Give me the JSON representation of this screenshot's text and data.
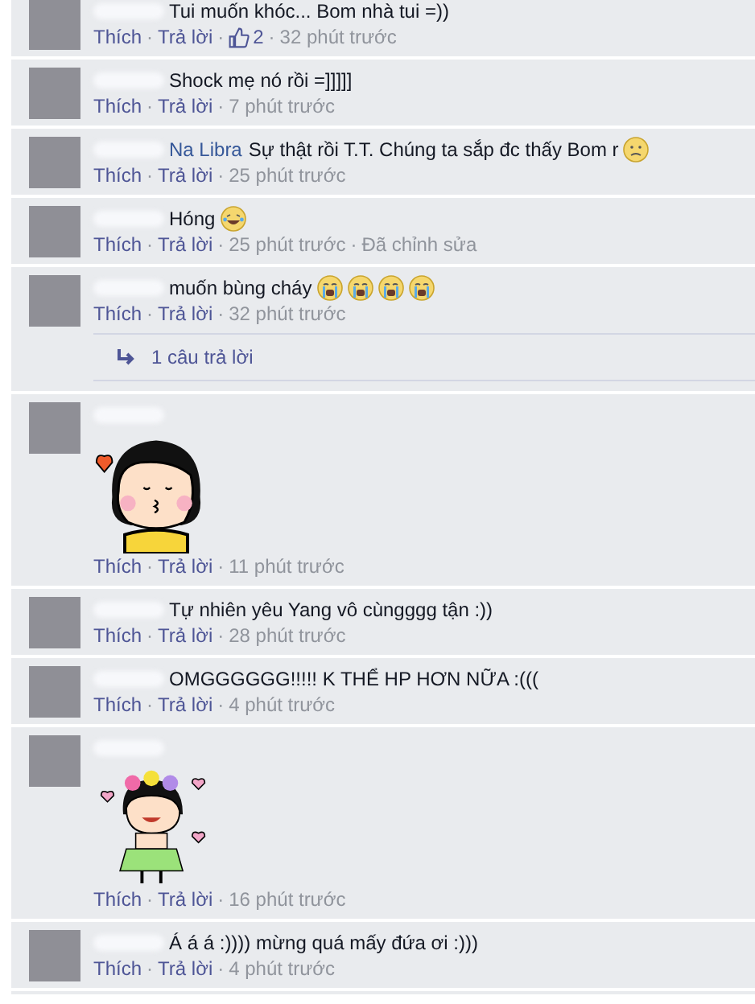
{
  "comments": [
    {
      "kind": "text",
      "body": [
        {
          "kind": "text",
          "text": "Tui muốn khóc... Bom nhà tui =))"
        }
      ],
      "footer": [
        {
          "kind": "link",
          "text": "Thích"
        },
        {
          "kind": "dot",
          "text": "·"
        },
        {
          "kind": "link",
          "text": "Trả lời"
        },
        {
          "kind": "dot",
          "text": "·"
        },
        {
          "kind": "likes",
          "text": "2"
        },
        {
          "kind": "dot",
          "text": "·"
        },
        {
          "kind": "time",
          "text": "32 phút trước"
        }
      ]
    },
    {
      "kind": "text",
      "body": [
        {
          "kind": "text",
          "text": "Shock mẹ nó rồi =]]]]]"
        }
      ],
      "footer": [
        {
          "kind": "link",
          "text": "Thích"
        },
        {
          "kind": "dot",
          "text": "·"
        },
        {
          "kind": "link",
          "text": "Trả lời"
        },
        {
          "kind": "dot",
          "text": "·"
        },
        {
          "kind": "time",
          "text": "7 phút trước"
        }
      ]
    },
    {
      "kind": "text",
      "body": [
        {
          "kind": "name",
          "text": "Na Libra"
        },
        {
          "kind": "text",
          "text": "Sự thật rồi T.T. Chúng ta sắp đc thấy Bom r"
        },
        {
          "kind": "frown"
        }
      ],
      "footer": [
        {
          "kind": "link",
          "text": "Thích"
        },
        {
          "kind": "dot",
          "text": "·"
        },
        {
          "kind": "link",
          "text": "Trả lời"
        },
        {
          "kind": "dot",
          "text": "·"
        },
        {
          "kind": "time",
          "text": "25 phút trước"
        }
      ]
    },
    {
      "kind": "text",
      "body": [
        {
          "kind": "text",
          "text": "Hóng"
        },
        {
          "kind": "laugh-tears"
        }
      ],
      "footer": [
        {
          "kind": "link",
          "text": "Thích"
        },
        {
          "kind": "dot",
          "text": "·"
        },
        {
          "kind": "link",
          "text": "Trả lời"
        },
        {
          "kind": "dot",
          "text": "·"
        },
        {
          "kind": "time",
          "text": "25 phút trước"
        },
        {
          "kind": "dot",
          "text": "·"
        },
        {
          "kind": "time",
          "text": "Đã chỉnh sửa"
        }
      ]
    },
    {
      "kind": "text",
      "body": [
        {
          "kind": "text",
          "text": "muốn bùng cháy"
        },
        {
          "kind": "crying"
        },
        {
          "kind": "crying"
        },
        {
          "kind": "crying"
        },
        {
          "kind": "crying"
        }
      ],
      "footer": [
        {
          "kind": "link",
          "text": "Thích"
        },
        {
          "kind": "dot",
          "text": "·"
        },
        {
          "kind": "link",
          "text": "Trả lời"
        },
        {
          "kind": "dot",
          "text": "·"
        },
        {
          "kind": "time",
          "text": "32 phút trước"
        }
      ],
      "replies": "1 câu trả lời"
    },
    {
      "kind": "kiss-sticker",
      "footer": [
        {
          "kind": "link",
          "text": "Thích"
        },
        {
          "kind": "dot",
          "text": "·"
        },
        {
          "kind": "link",
          "text": "Trả lời"
        },
        {
          "kind": "dot",
          "text": "·"
        },
        {
          "kind": "time",
          "text": "11 phút trước"
        }
      ]
    },
    {
      "kind": "text",
      "body": [
        {
          "kind": "text",
          "text": "Tự nhiên yêu Yang vô cùngggg tận :))"
        }
      ],
      "footer": [
        {
          "kind": "link",
          "text": "Thích"
        },
        {
          "kind": "dot",
          "text": "·"
        },
        {
          "kind": "link",
          "text": "Trả lời"
        },
        {
          "kind": "dot",
          "text": "·"
        },
        {
          "kind": "time",
          "text": "28 phút trước"
        }
      ]
    },
    {
      "kind": "text",
      "body": [
        {
          "kind": "text",
          "text": "OMGGGGGG!!!!! K THỂ HP HƠN NỮA :((("
        }
      ],
      "footer": [
        {
          "kind": "link",
          "text": "Thích"
        },
        {
          "kind": "dot",
          "text": "·"
        },
        {
          "kind": "link",
          "text": "Trả lời"
        },
        {
          "kind": "dot",
          "text": "·"
        },
        {
          "kind": "time",
          "text": "4 phút trước"
        }
      ]
    },
    {
      "kind": "hula-sticker",
      "footer": [
        {
          "kind": "link",
          "text": "Thích"
        },
        {
          "kind": "dot",
          "text": "·"
        },
        {
          "kind": "link",
          "text": "Trả lời"
        },
        {
          "kind": "dot",
          "text": "·"
        },
        {
          "kind": "time",
          "text": "16 phút trước"
        }
      ]
    },
    {
      "kind": "text",
      "body": [
        {
          "kind": "text",
          "text": "Á á á :)))) mừng quá mấy đứa ơi :)))"
        }
      ],
      "footer": [
        {
          "kind": "link",
          "text": "Thích"
        },
        {
          "kind": "dot",
          "text": "·"
        },
        {
          "kind": "link",
          "text": "Trả lời"
        },
        {
          "kind": "dot",
          "text": "·"
        },
        {
          "kind": "time",
          "text": "4 phút trước"
        }
      ]
    }
  ]
}
